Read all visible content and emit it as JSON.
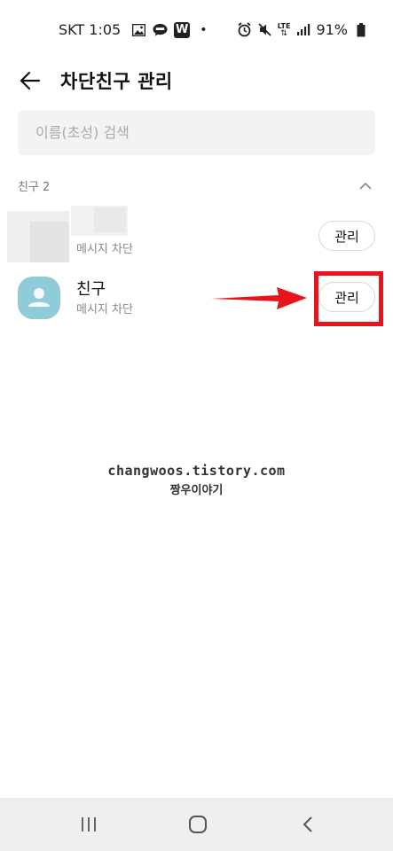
{
  "status_bar": {
    "carrier_time": "SKT 1:05",
    "w_badge": "W",
    "dot": "•",
    "lte": "LTE",
    "battery": "91%"
  },
  "header": {
    "title": "차단친구 관리"
  },
  "search": {
    "placeholder": "이름(초성) 검색"
  },
  "section": {
    "label": "친구 2"
  },
  "friends": [
    {
      "name": "",
      "status": "메시지 차단",
      "manage_label": "관리"
    },
    {
      "name": "친구",
      "status": "메시지 차단",
      "manage_label": "관리"
    }
  ],
  "watermark": {
    "line1": "changwoos.tistory.com",
    "line2": "짱우이야기"
  },
  "colors": {
    "accent_red": "#e8141c",
    "avatar_default": "#8fcbd9",
    "search_bg": "#f3f3f3",
    "nav_bg": "#efefef"
  },
  "icons": {
    "back": "arrow-left-icon",
    "collapse": "chevron-up-icon",
    "nav_recents": "recents-icon",
    "nav_home": "home-icon",
    "nav_back": "chevron-left-icon"
  }
}
